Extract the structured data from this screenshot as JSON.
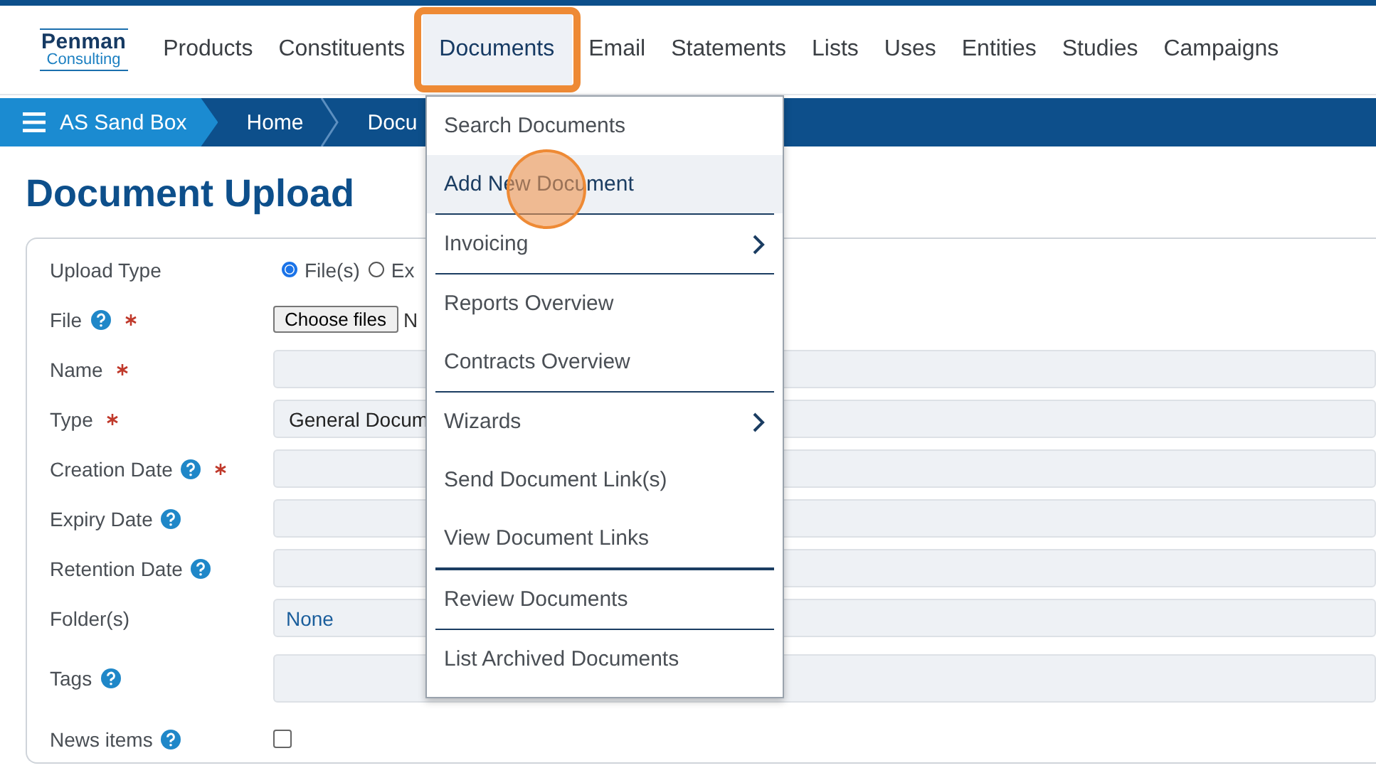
{
  "logo": {
    "line1": "Penman",
    "line2": "Consulting"
  },
  "nav": [
    {
      "label": "Products",
      "selected": false
    },
    {
      "label": "Constituents",
      "selected": false
    },
    {
      "label": "Documents",
      "selected": true
    },
    {
      "label": "Email",
      "selected": false
    },
    {
      "label": "Statements",
      "selected": false
    },
    {
      "label": "Lists",
      "selected": false
    },
    {
      "label": "Uses",
      "selected": false
    },
    {
      "label": "Entities",
      "selected": false
    },
    {
      "label": "Studies",
      "selected": false
    },
    {
      "label": "Campaigns",
      "selected": false
    }
  ],
  "breadcrumb": [
    {
      "label": "AS Sand Box",
      "kind": "root"
    },
    {
      "label": "Home",
      "kind": "crumb"
    },
    {
      "label": "Docu",
      "kind": "crumb"
    }
  ],
  "page_title": "Document Upload",
  "form": [
    {
      "label": "Upload Type",
      "kind": "radio",
      "options": [
        {
          "label": "File(s)",
          "selected": true
        },
        {
          "label": "Ex",
          "selected": false
        }
      ]
    },
    {
      "label": "File",
      "kind": "file",
      "help": true,
      "required": true,
      "button": "Choose files",
      "value": "N"
    },
    {
      "label": "Name",
      "kind": "text",
      "help": false,
      "required": true
    },
    {
      "label": "Type",
      "kind": "select",
      "help": false,
      "required": true,
      "value": "General Docum"
    },
    {
      "label": "Creation Date",
      "kind": "text",
      "help": true,
      "required": true
    },
    {
      "label": "Expiry Date",
      "kind": "text",
      "help": true,
      "required": false
    },
    {
      "label": "Retention Date",
      "kind": "text",
      "help": true,
      "required": false
    },
    {
      "label": "Folder(s)",
      "kind": "folder",
      "help": false,
      "required": false,
      "value": "None"
    },
    {
      "label": "Tags",
      "kind": "tall",
      "help": true,
      "required": false
    },
    {
      "label": "News items",
      "kind": "checkbox",
      "help": true,
      "required": false,
      "checked": false
    }
  ],
  "menu": [
    {
      "label": "Search Documents",
      "hovered": false,
      "submenu": false,
      "divider": false,
      "heavy_divider": false
    },
    {
      "label": "Add New Document",
      "hovered": true,
      "submenu": false,
      "divider": true,
      "heavy_divider": false
    },
    {
      "label": "Invoicing",
      "hovered": false,
      "submenu": true,
      "divider": true,
      "heavy_divider": false
    },
    {
      "label": "Reports Overview",
      "hovered": false,
      "submenu": false,
      "divider": false,
      "heavy_divider": false
    },
    {
      "label": "Contracts Overview",
      "hovered": false,
      "submenu": false,
      "divider": true,
      "heavy_divider": false
    },
    {
      "label": "Wizards",
      "hovered": false,
      "submenu": true,
      "divider": false,
      "heavy_divider": false
    },
    {
      "label": "Send Document Link(s)",
      "hovered": false,
      "submenu": false,
      "divider": false,
      "heavy_divider": false
    },
    {
      "label": "View Document Links",
      "hovered": false,
      "submenu": false,
      "divider": true,
      "heavy_divider": true
    },
    {
      "label": "Review Documents",
      "hovered": false,
      "submenu": false,
      "divider": true,
      "heavy_divider": false
    },
    {
      "label": "List Archived Documents",
      "hovered": false,
      "submenu": false,
      "divider": false,
      "heavy_divider": false
    }
  ]
}
